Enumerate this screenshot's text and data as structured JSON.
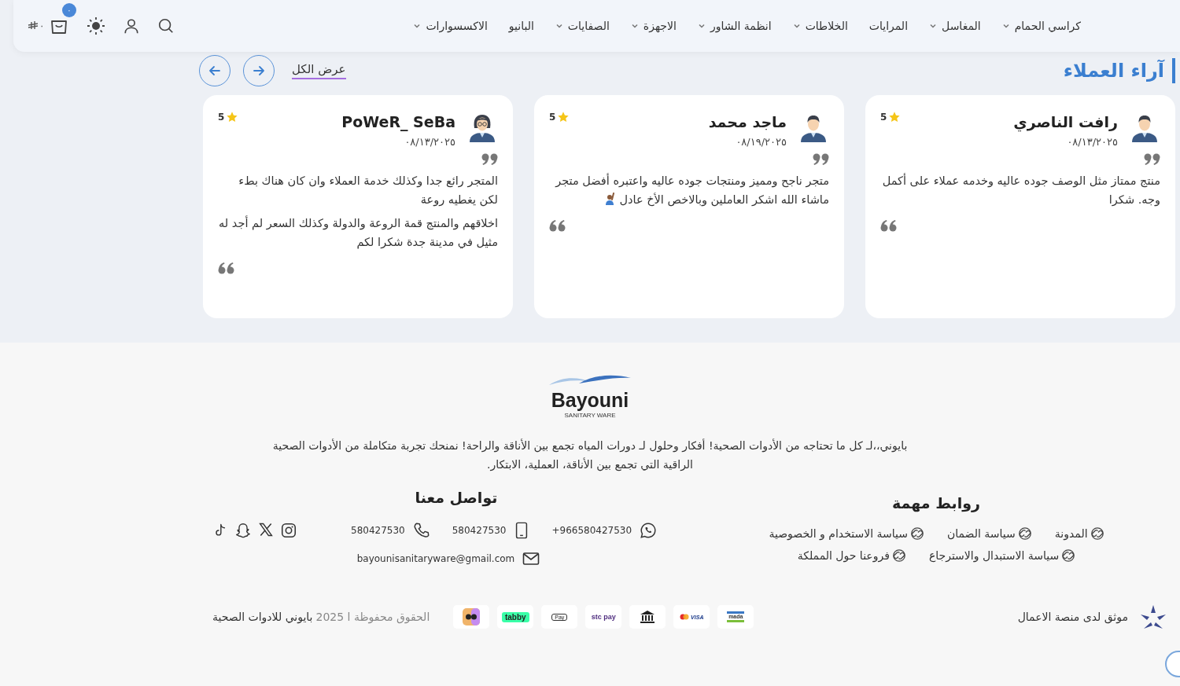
{
  "header": {
    "nav": [
      {
        "label": "كراسي الحمام",
        "has_dropdown": true
      },
      {
        "label": "المغاسل",
        "has_dropdown": true
      },
      {
        "label": "المرايات",
        "has_dropdown": false
      },
      {
        "label": "الخلاطات",
        "has_dropdown": true
      },
      {
        "label": "انظمة الشاور",
        "has_dropdown": true
      },
      {
        "label": "الاجهزة",
        "has_dropdown": true
      },
      {
        "label": "الصفايات",
        "has_dropdown": true
      },
      {
        "label": "البانيو",
        "has_dropdown": false
      },
      {
        "label": "الاكسسوارات",
        "has_dropdown": true
      }
    ],
    "cart": {
      "badge": "٠",
      "total": "٠"
    }
  },
  "reviews": {
    "title": "آراء العملاء",
    "view_all": "عرض الكل",
    "items": [
      {
        "name": "رافت الناصري",
        "date": "٠٨/١٣/٢٠٢٥",
        "rating": "5",
        "kind": "male",
        "paragraphs": [
          "منتج ممتاز مثل الوصف جوده عاليه وخدمه عملاء على أكمل وجه. شكرا"
        ],
        "emoji_icon": false
      },
      {
        "name": "ماجد محمد",
        "date": "٠٨/١٩/٢٠٢٥",
        "rating": "5",
        "kind": "male",
        "paragraphs": [
          "متجر ناجح ومميز ومنتجات جوده عاليه واعتبره أفضل متجر ماشاء الله اشكر العاملين وبالاخص الأخ عادل"
        ],
        "emoji_icon": true
      },
      {
        "name": "PoWeR_ SeBa",
        "date": "٠٨/١٣/٢٠٢٥",
        "rating": "5",
        "kind": "female",
        "paragraphs": [
          "المتجر رائع جدا وكذلك خدمة العملاء وان كان هناك بطء لكن يغطيه روعة",
          "اخلاقهم والمنتج قمة الروعة والدولة وكذلك السعر لم أجد له مثيل في مدينة جدة شكرا لكم"
        ],
        "emoji_icon": false
      }
    ]
  },
  "footer": {
    "brand": "Bayouni",
    "tagline": "SANITARY WARE",
    "description": "بايوني،،لـ كل ما تحتاجه من الأدوات الصحية! أفكار وحلول لـ دورات المياه تجمع بين الأناقة والراحة! نمنحك تجربة متكاملة من الأدوات الصحية الراقية التي تجمع بين الأناقة، العملية، الابتكار.",
    "links": {
      "title": "روابط مهمة",
      "items": [
        "المدونة",
        "سياسة الضمان",
        "سياسة الاستخدام و الخصوصية",
        "سياسة الاستبدال والاسترجاع",
        "فروعنا حول المملكة"
      ]
    },
    "contact": {
      "title": "تواصل معنا",
      "items": [
        {
          "kind": "whatsapp",
          "value": "+966580427530"
        },
        {
          "kind": "mobile",
          "value": "580427530"
        },
        {
          "kind": "phone",
          "value": "580427530"
        },
        {
          "kind": "email",
          "value": "bayounisanitaryware@gmail.com"
        }
      ],
      "social": [
        {
          "kind": "instagram"
        },
        {
          "kind": "x"
        },
        {
          "kind": "snapchat"
        },
        {
          "kind": "tiktok"
        }
      ]
    },
    "trust": "موثق لدى منصة الاعمال",
    "payments": [
      {
        "kind": "mada",
        "label": "mada"
      },
      {
        "kind": "visa",
        "label": "VISA"
      },
      {
        "kind": "bank"
      },
      {
        "kind": "stcpay",
        "label": "stc pay"
      },
      {
        "kind": "applepay",
        "label": "Pay"
      },
      {
        "kind": "tabby",
        "label": "tabby"
      },
      {
        "kind": "wallet"
      }
    ],
    "copyright": {
      "notice": "الحقوق محفوظة ا 2025",
      "owner": "بايوني للادوات الصحية"
    }
  }
}
